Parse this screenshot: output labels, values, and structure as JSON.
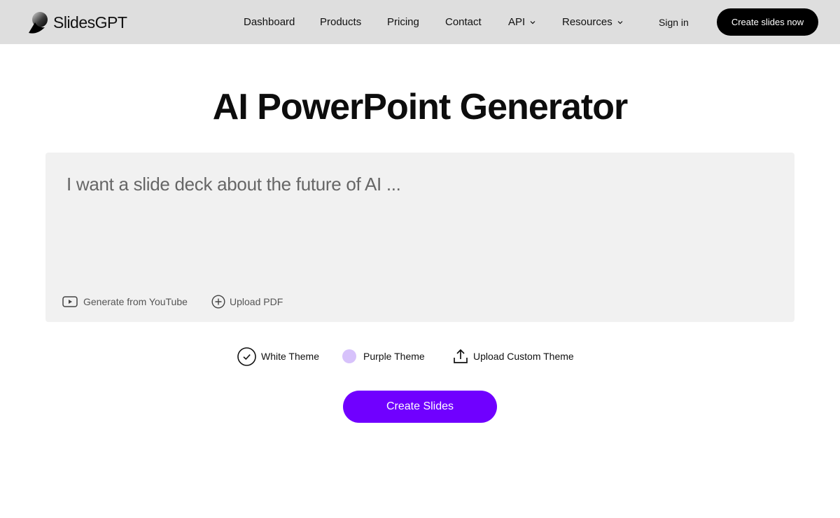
{
  "header": {
    "brand": "SlidesGPT",
    "nav": [
      {
        "label": "Dashboard"
      },
      {
        "label": "Products"
      },
      {
        "label": "Pricing"
      },
      {
        "label": "Contact"
      },
      {
        "label": "API",
        "has_dropdown": true
      },
      {
        "label": "Resources",
        "has_dropdown": true
      }
    ],
    "sign_in": "Sign in",
    "cta": "Create slides now"
  },
  "hero": {
    "title": "AI PowerPoint Generator"
  },
  "prompt": {
    "value": "",
    "placeholder": "I want a slide deck about the future of AI ...",
    "actions": {
      "youtube": "Generate from YouTube",
      "pdf": "Upload PDF"
    }
  },
  "themes": {
    "white": {
      "label": "White Theme",
      "selected": true
    },
    "purple": {
      "label": "Purple Theme",
      "selected": false,
      "color": "#d7c2fb"
    },
    "custom": {
      "label": "Upload Custom Theme"
    }
  },
  "create_button": "Create Slides",
  "colors": {
    "header_bg": "#dedede",
    "card_bg": "#f1f1f1",
    "accent": "#7000ff",
    "primary_dark": "#000000"
  },
  "icons": {
    "logo": "slidesgpt-logo-icon",
    "api_dropdown": "chevron-down-icon",
    "resources_dropdown": "chevron-down-icon",
    "youtube": "play-icon",
    "pdf": "plus-circle-icon",
    "white_theme": "check-circle-icon",
    "custom_theme": "upload-icon"
  }
}
